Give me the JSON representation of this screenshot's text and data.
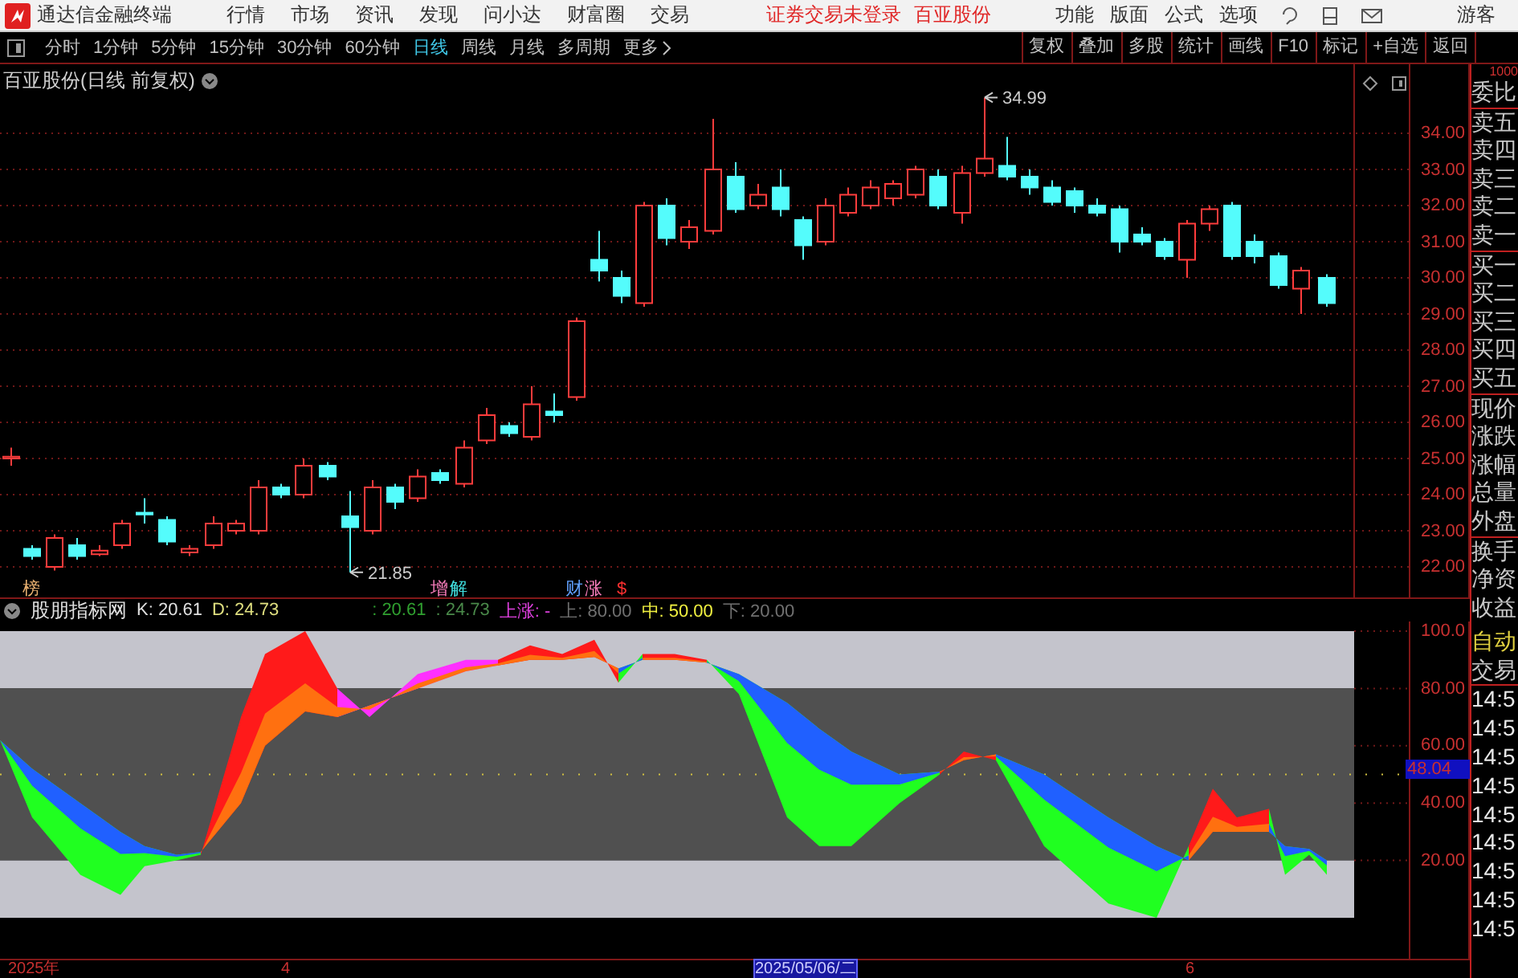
{
  "menu_bar": {
    "app_title": "通达信金融终端",
    "menus": [
      "行情",
      "市场",
      "资讯",
      "发现",
      "问小达",
      "财富圈",
      "交易"
    ],
    "login_status": "证券交易未登录",
    "stock_name": "百亚股份",
    "tools": [
      "功能",
      "版面",
      "公式",
      "选项"
    ],
    "user": "游客"
  },
  "period_bar": {
    "periods": [
      {
        "label": "分时",
        "selected": false
      },
      {
        "label": "1分钟",
        "selected": false
      },
      {
        "label": "5分钟",
        "selected": false
      },
      {
        "label": "15分钟",
        "selected": false
      },
      {
        "label": "30分钟",
        "selected": false
      },
      {
        "label": "60分钟",
        "selected": false
      },
      {
        "label": "日线",
        "selected": true
      },
      {
        "label": "周线",
        "selected": false
      },
      {
        "label": "月线",
        "selected": false
      },
      {
        "label": "多周期",
        "selected": false
      }
    ],
    "more": "更多",
    "buttons": [
      "复权",
      "叠加",
      "多股",
      "统计",
      "画线",
      "F10",
      "标记",
      "+自选",
      "返回"
    ]
  },
  "price_chart": {
    "title": "百亚股份(日线 前复权)",
    "high_label": "34.99",
    "low_label": "21.85",
    "y_axis_labels": [
      "34.00",
      "33.00",
      "32.00",
      "31.00",
      "30.00",
      "29.00",
      "28.00",
      "27.00",
      "26.00",
      "25.00",
      "24.00",
      "23.00",
      "22.00"
    ],
    "event_markers": [
      {
        "text": "榜",
        "color": "#e8b070"
      },
      {
        "text": "增",
        "color": "#ff80c0"
      },
      {
        "text": "解",
        "color": "#40e0e0"
      },
      {
        "text": "财",
        "color": "#60a0ff"
      },
      {
        "text": "涨",
        "color": "#ff80c0"
      },
      {
        "text": "$",
        "color": "#ff3030"
      }
    ]
  },
  "indicator": {
    "name": "股朋指标网",
    "values": [
      {
        "text": "K: 20.61",
        "color": "#e0e0e0"
      },
      {
        "text": "D: 24.73",
        "color": "#e0e080"
      },
      {
        "text": ": 20.61",
        "color": "#30a030"
      },
      {
        "text": ": 24.73",
        "color": "#4a8a4a"
      },
      {
        "text": "上涨: -",
        "color": "#e040e0"
      },
      {
        "text": "上: 80.00",
        "color": "#707070"
      },
      {
        "text": "中: 50.00",
        "color": "#f0f040"
      },
      {
        "text": "下: 20.00",
        "color": "#707070"
      }
    ],
    "y_axis_labels": [
      "100.0",
      "80.00",
      "60.00",
      "40.00",
      "20.00"
    ],
    "current_value": "48.04"
  },
  "date_axis": [
    {
      "label": "2025年",
      "selected": false
    },
    {
      "label": "4",
      "selected": false
    },
    {
      "label": "2025/05/06/二",
      "selected": true
    },
    {
      "label": "6",
      "selected": false
    }
  ],
  "quote_panel": {
    "scale": "1000",
    "labels": [
      "委比",
      "卖五",
      "卖四",
      "卖三",
      "卖二",
      "卖一",
      "买一",
      "买二",
      "买三",
      "买四",
      "买五",
      "现价",
      "涨跌",
      "涨幅",
      "总量",
      "外盘",
      "换手",
      "净资",
      "收益"
    ],
    "mode": "自动",
    "trade_header": "交易",
    "trade_times": [
      "14:5",
      "14:5",
      "14:5",
      "14:5",
      "14:5",
      "14:5",
      "14:5",
      "14:5",
      "14:5"
    ]
  }
}
